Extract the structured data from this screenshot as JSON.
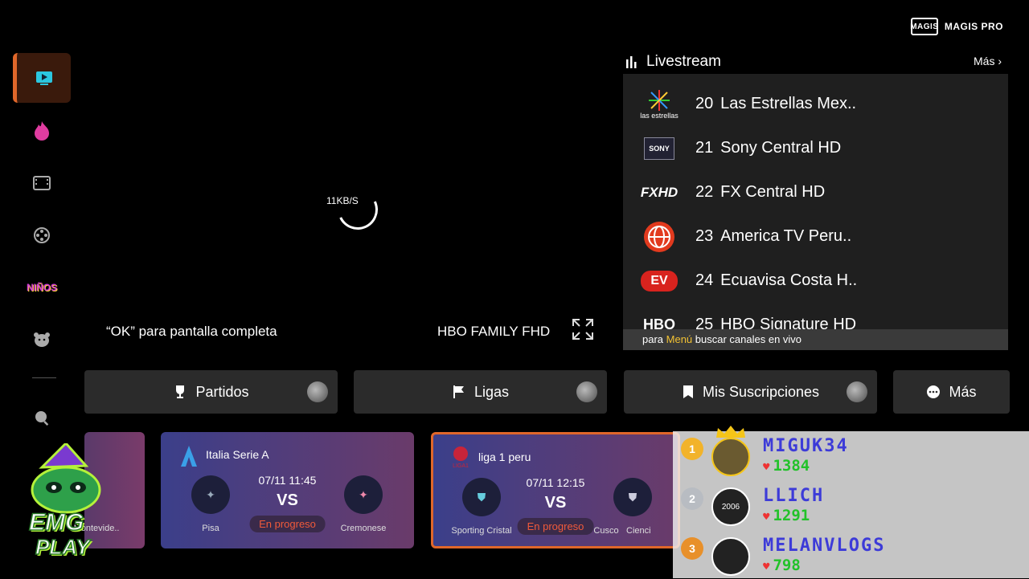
{
  "brand": {
    "logo_text": "MAGIS",
    "name": "MAGIS PRO"
  },
  "sidebar": {
    "items": [
      {
        "name": "live-tv",
        "icon": "tv-play-icon",
        "active": true
      },
      {
        "name": "hot",
        "icon": "flame-icon"
      },
      {
        "name": "movies",
        "icon": "film-icon"
      },
      {
        "name": "series",
        "icon": "film-reel-icon"
      },
      {
        "name": "kids",
        "icon": "ninos-icon",
        "label": "NIÑOS"
      },
      {
        "name": "bear",
        "icon": "bear-icon"
      },
      {
        "name": "search",
        "icon": "search-icon"
      }
    ]
  },
  "player": {
    "speed": "11KB/S",
    "ok_hint": "“OK” para pantalla completa",
    "current_channel": "HBO FAMILY FHD"
  },
  "livestream": {
    "title": "Livestream",
    "more": "Más",
    "channels": [
      {
        "num": "20",
        "name": "Las Estrellas Mex..",
        "logo": "las estrellas"
      },
      {
        "num": "21",
        "name": "Sony Central HD",
        "logo": "SONY"
      },
      {
        "num": "22",
        "name": "FX Central HD",
        "logo": "FXHD"
      },
      {
        "num": "23",
        "name": "America TV Peru..",
        "logo": "america-globe-icon"
      },
      {
        "num": "24",
        "name": "Ecuavisa Costa H..",
        "logo": "EV"
      },
      {
        "num": "25",
        "name": "HBO Signature HD",
        "logo": "HBO"
      }
    ],
    "footer_pre": "para ",
    "footer_hl": "Menú",
    "footer_post": " buscar canales en vivo"
  },
  "tabs": [
    {
      "label": "Partidos",
      "icon": "trophy-icon"
    },
    {
      "label": "Ligas",
      "icon": "flag-icon"
    },
    {
      "label": "Mis Suscripciones",
      "icon": "bookmark-icon"
    },
    {
      "label": "Más",
      "icon": "more-dots-icon"
    }
  ],
  "matches": [
    {
      "league": "",
      "team_a": "Montevide..",
      "team_b": ""
    },
    {
      "league": "Italia Serie A",
      "datetime": "07/11 11:45",
      "vs": "VS",
      "status": "En progreso",
      "team_a": "Pisa",
      "team_b": "Cremonese"
    },
    {
      "league": "liga 1 peru",
      "datetime": "07/11 12:15",
      "vs": "VS",
      "status": "En progreso",
      "team_a": "Sporting Cristal",
      "team_b": "Cusco",
      "extra": "Cienci"
    }
  ],
  "leaderboard": [
    {
      "rank": "1",
      "name": "MIGUK34",
      "score": "1384",
      "avatar": ""
    },
    {
      "rank": "2",
      "name": "LLICH",
      "score": "1291",
      "avatar": "2006"
    },
    {
      "rank": "3",
      "name": "MELANVLOGS",
      "score": "798",
      "avatar": ""
    }
  ],
  "mascot": {
    "line1": "EMG",
    "line2": "PLAY"
  },
  "colors": {
    "accent": "#e0672a",
    "highlight": "#f2c233",
    "status": "#f05a3a",
    "lb_name": "#3d3bd8",
    "lb_score": "#22c22a"
  }
}
